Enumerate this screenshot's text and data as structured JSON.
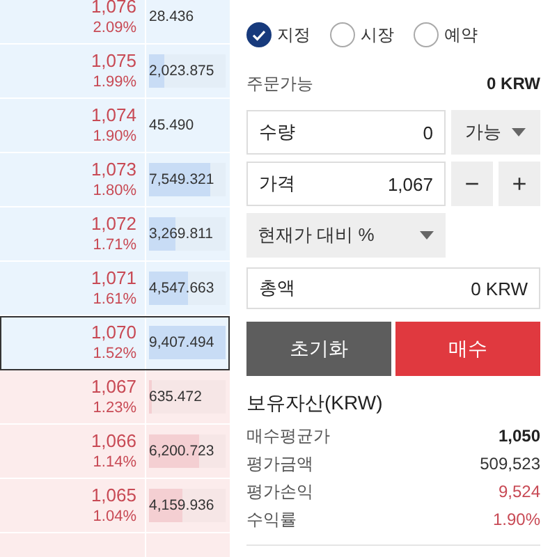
{
  "orderbook": {
    "rows": [
      {
        "kind": "ask",
        "price": "1,076",
        "change": "2.09%",
        "volume": "28.436",
        "selected": false
      },
      {
        "kind": "ask",
        "price": "1,075",
        "change": "1.99%",
        "volume": "2,023.875",
        "level": 0.2,
        "selected": false
      },
      {
        "kind": "ask",
        "price": "1,074",
        "change": "1.90%",
        "volume": "45.490",
        "selected": false
      },
      {
        "kind": "ask",
        "price": "1,073",
        "change": "1.80%",
        "volume": "7,549.321",
        "level": 0.8,
        "selected": false
      },
      {
        "kind": "ask",
        "price": "1,072",
        "change": "1.71%",
        "volume": "3,269.811",
        "level": 0.35,
        "selected": false
      },
      {
        "kind": "ask",
        "price": "1,071",
        "change": "1.61%",
        "volume": "4,547.663",
        "level": 0.5,
        "selected": false
      },
      {
        "kind": "ask",
        "price": "1,070",
        "change": "1.52%",
        "volume": "9,407.494",
        "level": 1.0,
        "selected": true
      },
      {
        "kind": "bid",
        "price": "1,067",
        "change": "1.23%",
        "volume": "635.472",
        "level": 0.04,
        "selected": false
      },
      {
        "kind": "bid",
        "price": "1,066",
        "change": "1.14%",
        "volume": "6,200.723",
        "level": 0.66,
        "selected": false
      },
      {
        "kind": "bid",
        "price": "1,065",
        "change": "1.04%",
        "volume": "4,159.936",
        "level": 0.44,
        "selected": false
      }
    ]
  },
  "order_type": [
    {
      "label": "지정",
      "selected": true
    },
    {
      "label": "시장",
      "selected": false
    },
    {
      "label": "예약",
      "selected": false
    }
  ],
  "available": {
    "label": "주문가능",
    "value": "0 KRW"
  },
  "quantity": {
    "label": "수량",
    "value": "0",
    "dropdown": "가능"
  },
  "price": {
    "label": "가격",
    "value": "1,067",
    "minus": "−",
    "plus": "+"
  },
  "price_mode": {
    "value": "현재가 대비 %"
  },
  "total": {
    "label": "총액",
    "value": "0 KRW"
  },
  "buttons": {
    "reset": "초기화",
    "buy": "매수"
  },
  "holdings": {
    "title": "보유자산(KRW)",
    "rows": [
      {
        "label": "매수평균가",
        "value": "1,050",
        "kind": "bold"
      },
      {
        "label": "평가금액",
        "value": "509,523",
        "kind": "plain"
      },
      {
        "label": "평가손익",
        "value": "9,524",
        "kind": "up"
      },
      {
        "label": "수익률",
        "value": "1.90%",
        "kind": "up"
      }
    ]
  }
}
